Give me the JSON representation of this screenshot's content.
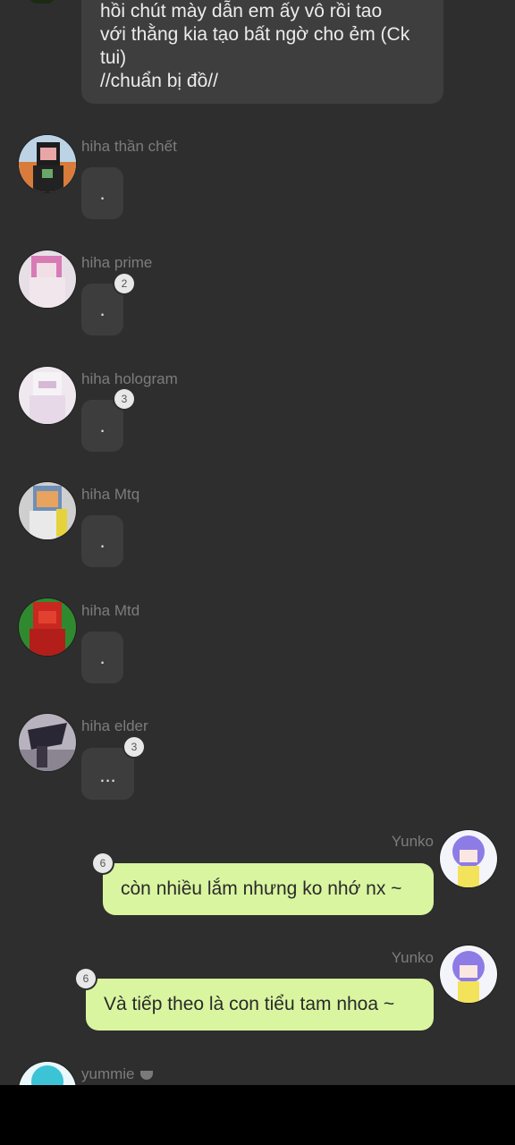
{
  "top_message": {
    "lines": [
      "hồi chút mày dẫn em ấy vô rồi tao",
      "với thằng kia tạo bất ngờ cho ẻm (Ck",
      "tui)",
      "//chuẩn bị đồ//"
    ]
  },
  "messages": [
    {
      "user": "hiha thần chết",
      "text": ".",
      "badge": ""
    },
    {
      "user": "hiha prime",
      "text": ".",
      "badge": "2"
    },
    {
      "user": "hiha hologram",
      "text": ".",
      "badge": "3"
    },
    {
      "user": "hiha Mtq",
      "text": ".",
      "badge": ""
    },
    {
      "user": "hiha Mtd",
      "text": ".",
      "badge": ""
    },
    {
      "user": "hiha elder",
      "text": "...",
      "badge": "3"
    }
  ],
  "own_messages": [
    {
      "user": "Yunko",
      "text": "còn nhiều lắm nhưng ko nhớ nx ~",
      "badge": "6"
    },
    {
      "user": "Yunko",
      "text": "Và tiếp theo là con tiểu tam nhoa ~",
      "badge": "6"
    }
  ],
  "last_user": {
    "user": "yummie"
  },
  "colors": {
    "background": "#2e2e2e",
    "bubble": "#3d3d3d",
    "own_bubble": "#d9f5a0",
    "username": "#7c7c7c",
    "nav_bar": "#000000"
  }
}
